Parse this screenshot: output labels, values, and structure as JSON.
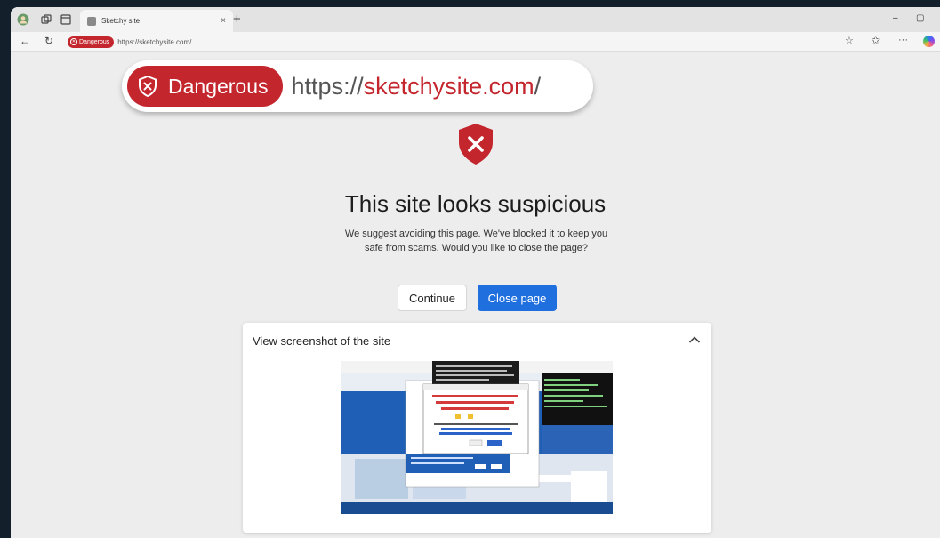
{
  "browser": {
    "tab_title": "Sketchy site",
    "tab_close": "×",
    "new_tab": "+",
    "address_badge": "Dangerous",
    "address_url": "https://sketchysite.com/",
    "minimize": "–",
    "maximize": "▢"
  },
  "banner": {
    "badge_label": "Dangerous",
    "url_scheme": "https://",
    "url_domain": "sketchysite.com",
    "url_path": "/"
  },
  "warning": {
    "headline": "This site looks suspicious",
    "description": "We suggest avoiding this page. We've blocked it to keep you safe from scams. Would you like to close the page?",
    "continue_label": "Continue",
    "close_label": "Close page"
  },
  "screenshot_panel": {
    "title": "View screenshot of the site"
  },
  "colors": {
    "danger": "#c4262e",
    "primary": "#1f6fde"
  }
}
